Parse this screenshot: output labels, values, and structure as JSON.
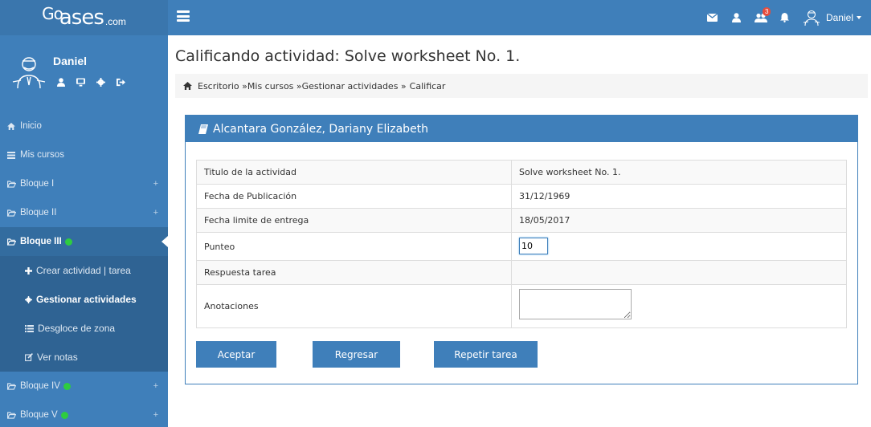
{
  "brand": {
    "logo_main": "Cl",
    "logo_mid": "ases",
    "logo_suffix": ".com",
    "logo_prefix": "Go"
  },
  "topbar": {
    "notifications_badge": "3",
    "user_name": "Daniel"
  },
  "sidebar": {
    "profile_name": "Daniel",
    "items": [
      {
        "label": "Inicio"
      },
      {
        "label": "Mis cursos"
      },
      {
        "label": "Bloque I",
        "plus": "+"
      },
      {
        "label": "Bloque II",
        "plus": "+"
      },
      {
        "label": "Bloque III"
      },
      {
        "label": "Bloque IV",
        "plus": "+"
      },
      {
        "label": "Bloque V",
        "plus": "+"
      }
    ],
    "subitems": [
      {
        "label": "Crear actividad | tarea"
      },
      {
        "label": "Gestionar actividades"
      },
      {
        "label": "Desgloce de zona"
      },
      {
        "label": "Ver notas"
      }
    ]
  },
  "main": {
    "title": "Calificando actividad: Solve worksheet No. 1.",
    "breadcrumb": {
      "b1": "Escritorio »",
      "b2": "Mis cursos »",
      "b3": "Gestionar actividades »",
      "b4": "Calificar"
    },
    "panel_title": "Alcantara González, Dariany Elizabeth",
    "rows": {
      "titulo_label": "Titulo de la actividad",
      "titulo_value": "Solve worksheet No. 1.",
      "fecha_pub_label": "Fecha de Publicación",
      "fecha_pub_value": "31/12/1969",
      "fecha_lim_label": "Fecha limite de entrega",
      "fecha_lim_value": "18/05/2017",
      "punteo_label": "Punteo",
      "punteo_value": "10",
      "respuesta_label": "Respuesta tarea",
      "anotaciones_label": "Anotaciones",
      "anotaciones_value": ""
    },
    "buttons": {
      "accept": "Aceptar",
      "back": "Regresar",
      "repeat": "Repetir tarea"
    }
  },
  "colors": {
    "primary": "#3f7fba",
    "sidebar_dark": "#2f6393",
    "status_green": "#2ecc40"
  }
}
